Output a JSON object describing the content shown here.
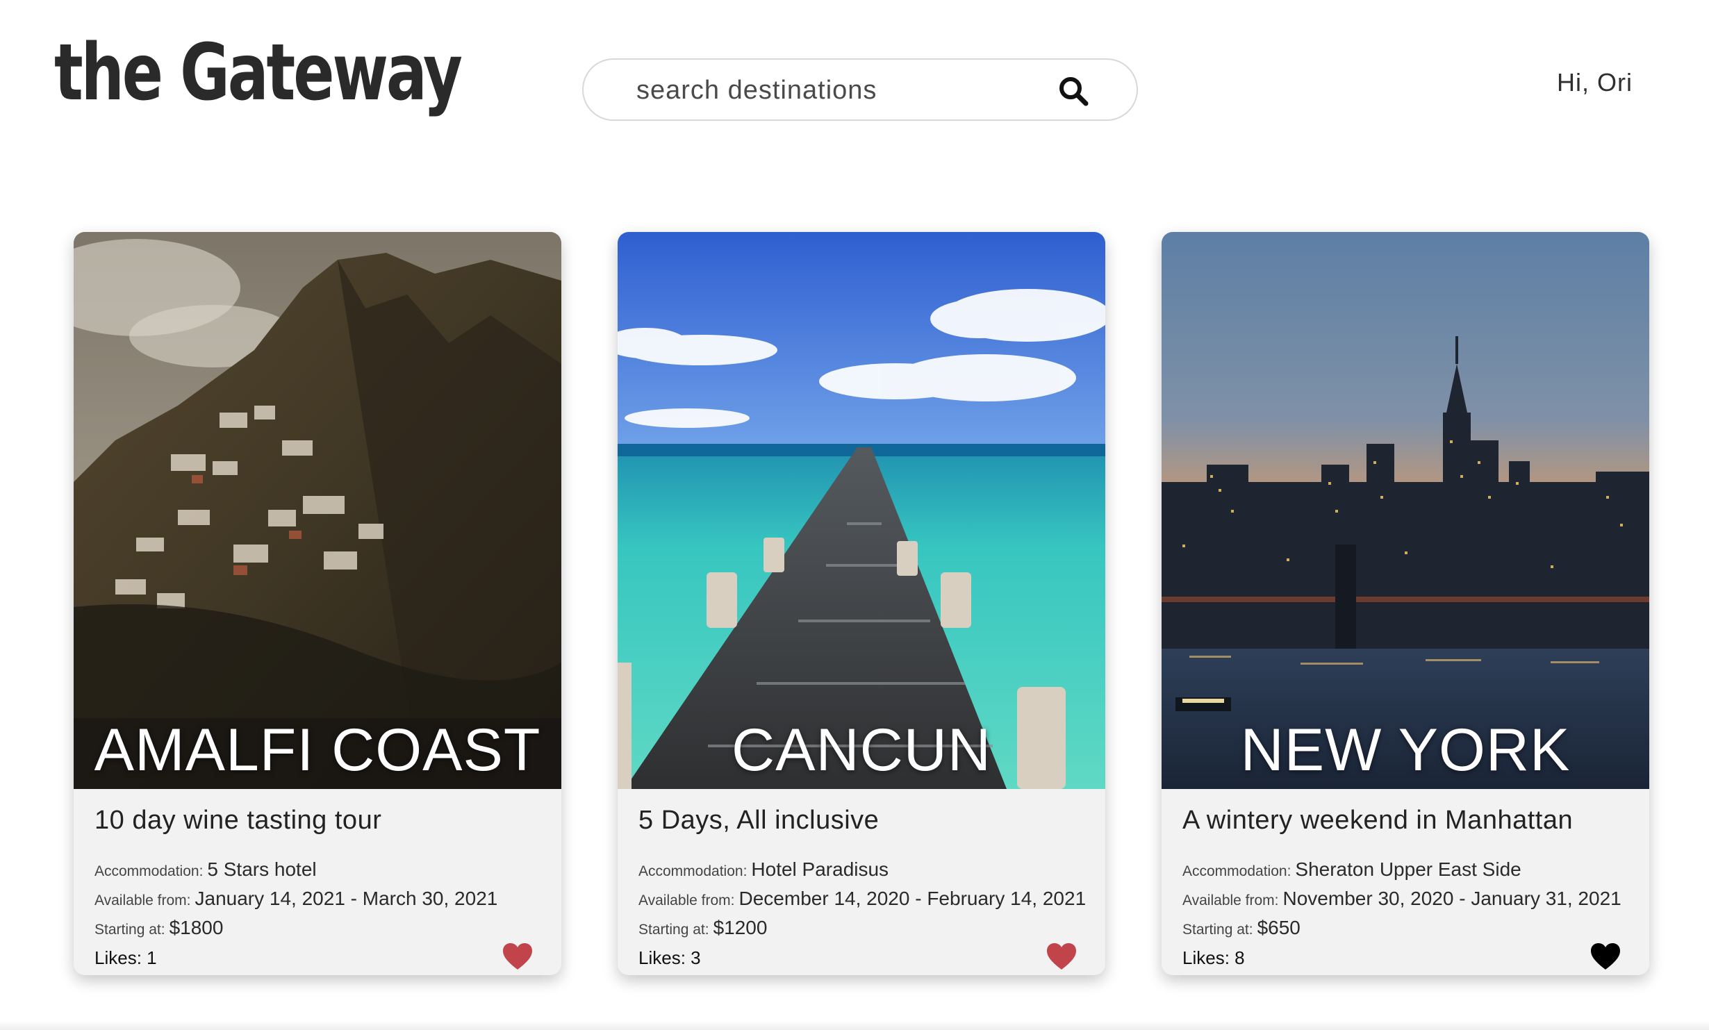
{
  "header": {
    "logo": "the Gateway",
    "search_placeholder": "search destinations",
    "greeting": "Hi, Ori"
  },
  "icons": {
    "search": "search-icon",
    "like": "heart-icon"
  },
  "colors": {
    "heart_liked": "#c0444a",
    "heart_default": "#000000"
  },
  "labels": {
    "accommodation": "Accommodation:",
    "available_from": "Available from:",
    "starting_at": "Starting at:",
    "likes": "Likes:"
  },
  "cards": [
    {
      "destination": "AMALFI COAST",
      "headline": "10 day wine tasting tour",
      "accommodation": "5 Stars hotel",
      "available": "January 14, 2021 - March 30, 2021",
      "price": "$1800",
      "likes": "Likes: 1",
      "heart_color": "#c0444a"
    },
    {
      "destination": "CANCUN",
      "headline": "5 Days, All inclusive",
      "accommodation": "Hotel Paradisus",
      "available": "December 14, 2020 - February 14, 2021",
      "price": "$1200",
      "likes": "Likes: 3",
      "heart_color": "#c0444a"
    },
    {
      "destination": "NEW YORK",
      "headline": "A wintery weekend in Manhattan",
      "accommodation": "Sheraton Upper East Side",
      "available": "November 30, 2020 - January 31, 2021",
      "price": "$650",
      "likes": "Likes: 8",
      "heart_color": "#000000"
    }
  ]
}
